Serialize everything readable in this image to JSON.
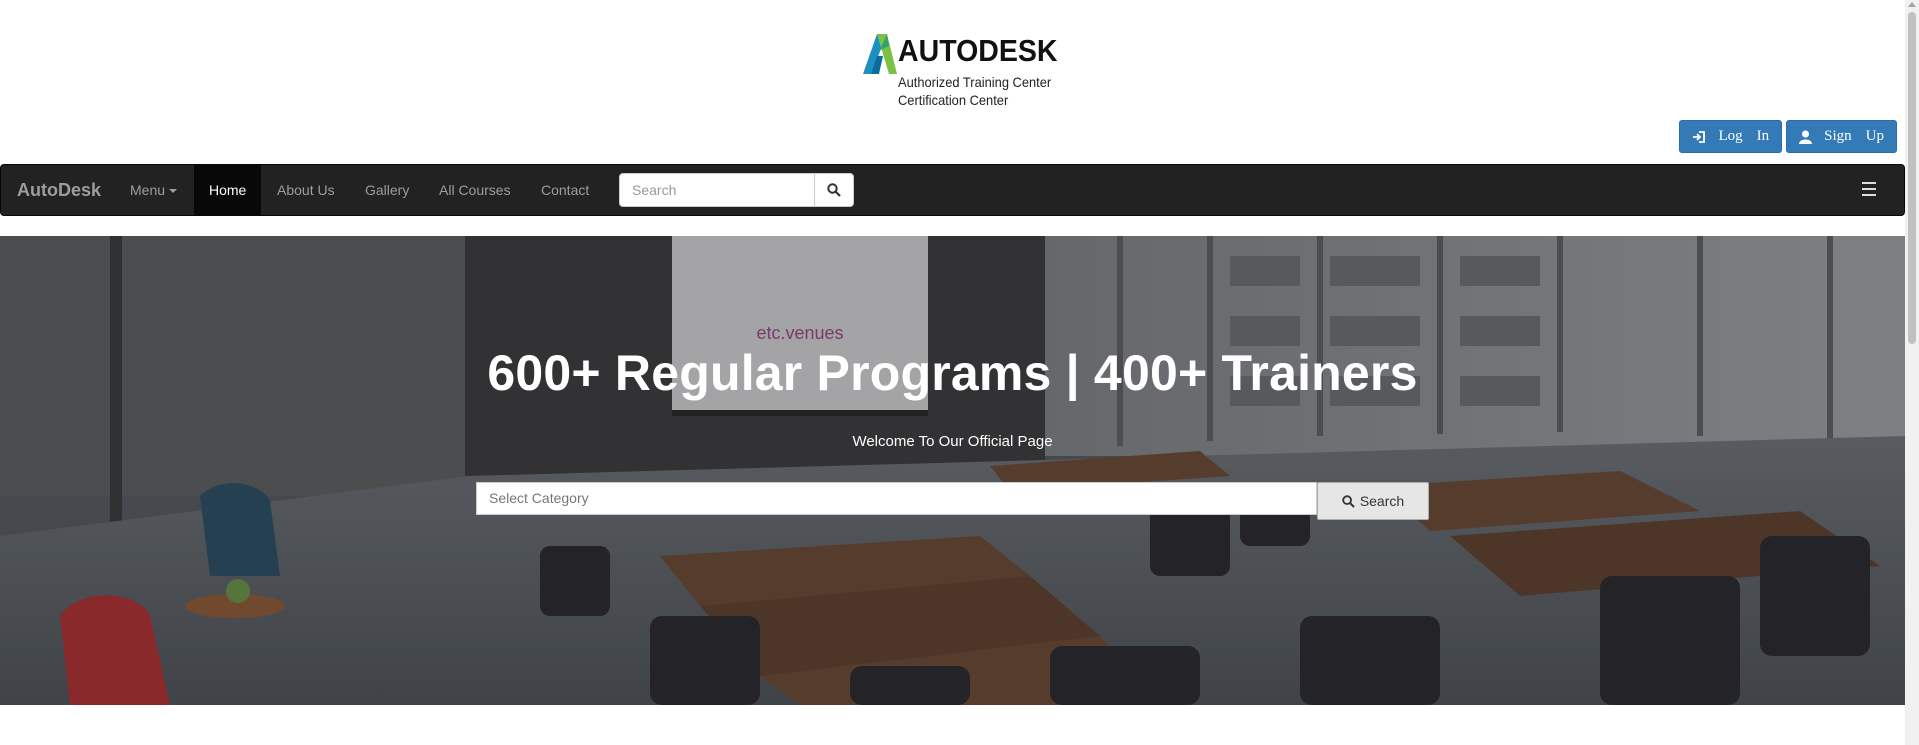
{
  "logo": {
    "word": "AUTODESK",
    "line1": "Authorized Training Center",
    "line2": "Certification Center"
  },
  "auth": {
    "login": [
      "Log",
      "In"
    ],
    "signup": [
      "Sign",
      "Up"
    ],
    "color": "#337ab7"
  },
  "navbar": {
    "brand": "AutoDesk",
    "items": [
      {
        "label": "Menu",
        "dropdown": true
      },
      {
        "label": "Home",
        "active": true
      },
      {
        "label": "About Us"
      },
      {
        "label": "Gallery"
      },
      {
        "label": "All Courses"
      },
      {
        "label": "Contact"
      }
    ],
    "search_placeholder": "Search"
  },
  "hero": {
    "title": "600+ Regular Programs | 400+ Trainers",
    "subtitle": "Welcome To Our Official Page",
    "category_placeholder": "Select Category",
    "search_label": "Search",
    "screen_text": "etc.venues"
  }
}
